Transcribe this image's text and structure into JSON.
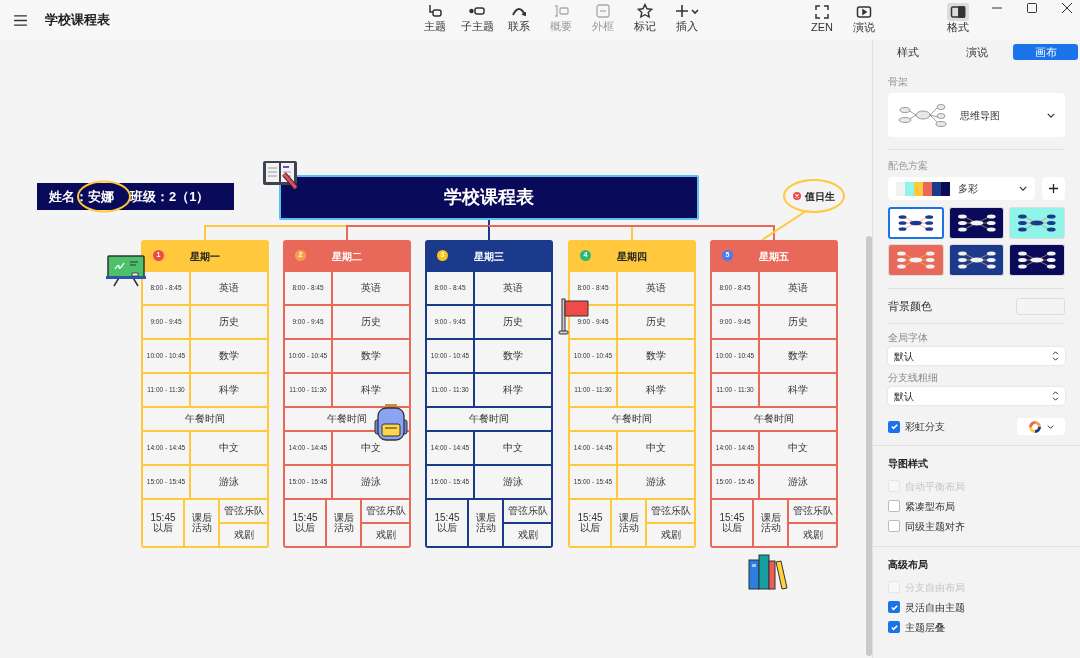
{
  "app": {
    "title": "学校课程表"
  },
  "toolbar": [
    {
      "label": "主题",
      "disabled": false
    },
    {
      "label": "子主题",
      "disabled": false
    },
    {
      "label": "联系",
      "disabled": false
    },
    {
      "label": "概要",
      "disabled": true
    },
    {
      "label": "外框",
      "disabled": true
    },
    {
      "label": "标记",
      "disabled": false
    },
    {
      "label": "插入",
      "disabled": false
    }
  ],
  "view_buttons": [
    {
      "label": "ZEN",
      "selected": false
    },
    {
      "label": "演说",
      "selected": false
    },
    {
      "label": "格式",
      "selected": true
    }
  ],
  "canvas": {
    "student": {
      "name_label": "姓名：安娜",
      "class_label": "班级：2（1）"
    },
    "central_topic": "学校课程表",
    "callout": {
      "label": "值日生"
    },
    "days": [
      {
        "badge": {
          "number": "1",
          "color": "#f04848"
        },
        "title": "星期一",
        "color": "#ffc83d",
        "rows": [
          {
            "kind": "slot",
            "time": "8:00 - 8:45",
            "subject": "英语"
          },
          {
            "kind": "slot",
            "time": "9:00 - 9:45",
            "subject": "历史"
          },
          {
            "kind": "slot",
            "time": "10:00 - 10:45",
            "subject": "数学"
          },
          {
            "kind": "slot",
            "time": "11:00 - 11:30",
            "subject": "科学"
          },
          {
            "kind": "lunch",
            "label": "午餐时间"
          },
          {
            "kind": "slot",
            "time": "14:00 - 14:45",
            "subject": "中文"
          },
          {
            "kind": "slot",
            "time": "15:00 - 15:45",
            "subject": "游泳"
          },
          {
            "kind": "after",
            "time": "15:45 以后",
            "activity": "课后活动",
            "options": [
              "管弦乐队",
              "戏剧"
            ]
          }
        ]
      },
      {
        "badge": {
          "number": "2",
          "color": "#f5a04a"
        },
        "title": "星期二",
        "color": "#e8695a",
        "rows": [
          {
            "kind": "slot",
            "time": "8:00 - 8:45",
            "subject": "英语"
          },
          {
            "kind": "slot",
            "time": "9:00 - 9:45",
            "subject": "历史"
          },
          {
            "kind": "slot",
            "time": "10:00 - 10:45",
            "subject": "数学"
          },
          {
            "kind": "slot",
            "time": "11:00 - 11:30",
            "subject": "科学"
          },
          {
            "kind": "lunch",
            "label": "午餐时间"
          },
          {
            "kind": "slot",
            "time": "14:00 - 14:45",
            "subject": "中文"
          },
          {
            "kind": "slot",
            "time": "15:00 - 15:45",
            "subject": "游泳"
          },
          {
            "kind": "after",
            "time": "15:45 以后",
            "activity": "课后活动",
            "options": [
              "管弦乐队",
              "戏剧"
            ]
          }
        ]
      },
      {
        "badge": {
          "number": "3",
          "color": "#f5c518"
        },
        "title": "星期三",
        "color": "#1b3a8c",
        "rows": [
          {
            "kind": "slot",
            "time": "8:00 - 8:45",
            "subject": "英语"
          },
          {
            "kind": "slot",
            "time": "9:00 - 9:45",
            "subject": "历史"
          },
          {
            "kind": "slot",
            "time": "10:00 - 10:45",
            "subject": "数学"
          },
          {
            "kind": "slot",
            "time": "11:00 - 11:30",
            "subject": "科学"
          },
          {
            "kind": "lunch",
            "label": "午餐时间"
          },
          {
            "kind": "slot",
            "time": "14:00 - 14:45",
            "subject": "中文"
          },
          {
            "kind": "slot",
            "time": "15:00 - 15:45",
            "subject": "游泳"
          },
          {
            "kind": "after",
            "time": "15:45 以后",
            "activity": "课后活动",
            "options": [
              "管弦乐队",
              "戏剧"
            ]
          }
        ]
      },
      {
        "badge": {
          "number": "4",
          "color": "#2eb872"
        },
        "title": "星期四",
        "color": "#ffc83d",
        "rows": [
          {
            "kind": "slot",
            "time": "8:00 - 8:45",
            "subject": "英语"
          },
          {
            "kind": "slot",
            "time": "9:00 - 9:45",
            "subject": "历史"
          },
          {
            "kind": "slot",
            "time": "10:00 - 10:45",
            "subject": "数学"
          },
          {
            "kind": "slot",
            "time": "11:00 - 11:30",
            "subject": "科学"
          },
          {
            "kind": "lunch",
            "label": "午餐时间"
          },
          {
            "kind": "slot",
            "time": "14:00 - 14:45",
            "subject": "中文"
          },
          {
            "kind": "slot",
            "time": "15:00 - 15:45",
            "subject": "游泳"
          },
          {
            "kind": "after",
            "time": "15:45 以后",
            "activity": "课后活动",
            "options": [
              "管弦乐队",
              "戏剧"
            ]
          }
        ]
      },
      {
        "badge": {
          "number": "5",
          "color": "#4a7cf0"
        },
        "title": "星期五",
        "color": "#e8695a",
        "rows": [
          {
            "kind": "slot",
            "time": "8:00 - 8:45",
            "subject": "英语"
          },
          {
            "kind": "slot",
            "time": "9:00 - 9:45",
            "subject": "历史"
          },
          {
            "kind": "slot",
            "time": "10:00 - 10:45",
            "subject": "数学"
          },
          {
            "kind": "slot",
            "time": "11:00 - 11:30",
            "subject": "科学"
          },
          {
            "kind": "lunch",
            "label": "午餐时间"
          },
          {
            "kind": "slot",
            "time": "14:00 - 14:45",
            "subject": "中文"
          },
          {
            "kind": "slot",
            "time": "15:00 - 15:45",
            "subject": "游泳"
          },
          {
            "kind": "after",
            "time": "15:45 以后",
            "activity": "课后活动",
            "options": [
              "管弦乐队",
              "戏剧"
            ]
          }
        ]
      }
    ]
  },
  "panel": {
    "tabs": [
      {
        "label": "样式",
        "selected": false
      },
      {
        "label": "演说",
        "selected": false
      },
      {
        "label": "画布",
        "selected": true
      }
    ],
    "skeleton": {
      "label": "骨架",
      "value": "思维导图"
    },
    "color_scheme": {
      "label": "配色方案",
      "value": "多彩",
      "swatches": [
        {
          "color": "#f2f2f2"
        },
        {
          "color": "#8ef5e8"
        },
        {
          "color": "#ffc83d"
        },
        {
          "color": "#e8695a"
        },
        {
          "color": "#1b3a8c"
        },
        {
          "color": "#0a0a5a"
        }
      ],
      "themes": [
        {
          "color": "#ffffff",
          "selected": true
        },
        {
          "color": "#0a0a5a",
          "selected": false
        },
        {
          "color": "#8ef5e8",
          "selected": false
        },
        {
          "color": "#e8695a",
          "selected": false
        },
        {
          "color": "#1b3a8c",
          "selected": false
        },
        {
          "color": "#0a0a5a",
          "selected": false
        }
      ]
    },
    "background": {
      "label": "背景颜色"
    },
    "font": {
      "label": "全局字体",
      "value": "默认"
    },
    "branch_width": {
      "label": "分支线粗细",
      "value": "默认"
    },
    "rainbow": {
      "label": "彩虹分支",
      "checked": true
    },
    "sections": [
      {
        "title": "导图样式",
        "options": [
          {
            "label": "自动平衡布局",
            "checked": false,
            "disabled": true
          },
          {
            "label": "紧凑型布局",
            "checked": false,
            "disabled": false
          },
          {
            "label": "同级主题对齐",
            "checked": false,
            "disabled": false
          }
        ]
      },
      {
        "title": "高级布局",
        "options": [
          {
            "label": "分支自由布局",
            "checked": false,
            "disabled": true
          },
          {
            "label": "灵活自由主题",
            "checked": true,
            "disabled": false
          },
          {
            "label": "主题层叠",
            "checked": true,
            "disabled": false
          }
        ]
      }
    ]
  }
}
